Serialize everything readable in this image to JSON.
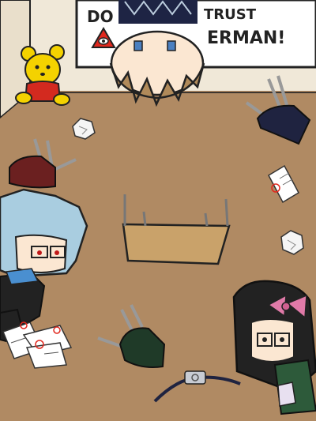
{
  "board": {
    "line1_left": "DO",
    "line1_right": "TRUST",
    "line2_right": "ERMAN!"
  },
  "colors": {
    "floor": "#b08a63",
    "wall": "#f0e8d8",
    "board": "#ffffff",
    "accent_red": "#e0281e",
    "desk_red": "#6b2020",
    "desk_navy": "#1f2340",
    "desk_green": "#1f3a28",
    "bear": "#f4d200",
    "shirt": "#d32a1f",
    "bow": "#e07aa8"
  },
  "icons": {
    "eye_triangle": "triangle-eye-icon"
  }
}
